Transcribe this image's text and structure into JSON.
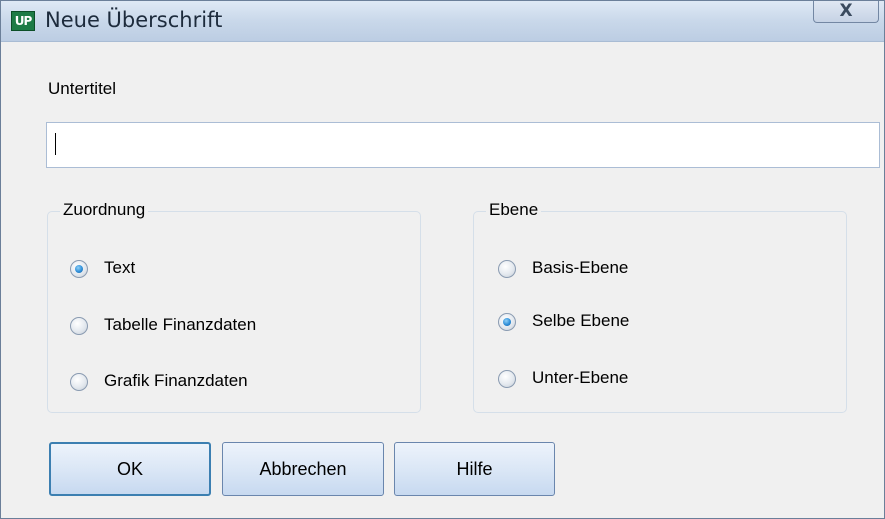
{
  "window": {
    "title": "Neue Überschrift",
    "app_icon_text": "UP",
    "close_label": "X"
  },
  "subtitle": {
    "label": "Untertitel",
    "value": ""
  },
  "assignment": {
    "legend": "Zuordnung",
    "options": [
      {
        "label": "Text",
        "checked": true
      },
      {
        "label": "Tabelle Finanzdaten",
        "checked": false
      },
      {
        "label": "Grafik Finanzdaten",
        "checked": false
      }
    ]
  },
  "level": {
    "legend": "Ebene",
    "options": [
      {
        "label": "Basis-Ebene",
        "checked": false
      },
      {
        "label": "Selbe Ebene",
        "checked": true
      },
      {
        "label": "Unter-Ebene",
        "checked": false
      }
    ]
  },
  "buttons": {
    "ok": "OK",
    "cancel": "Abbrechen",
    "help": "Hilfe"
  },
  "colors": {
    "accent": "#2f8fd9",
    "app_icon": "#1d7b46"
  }
}
